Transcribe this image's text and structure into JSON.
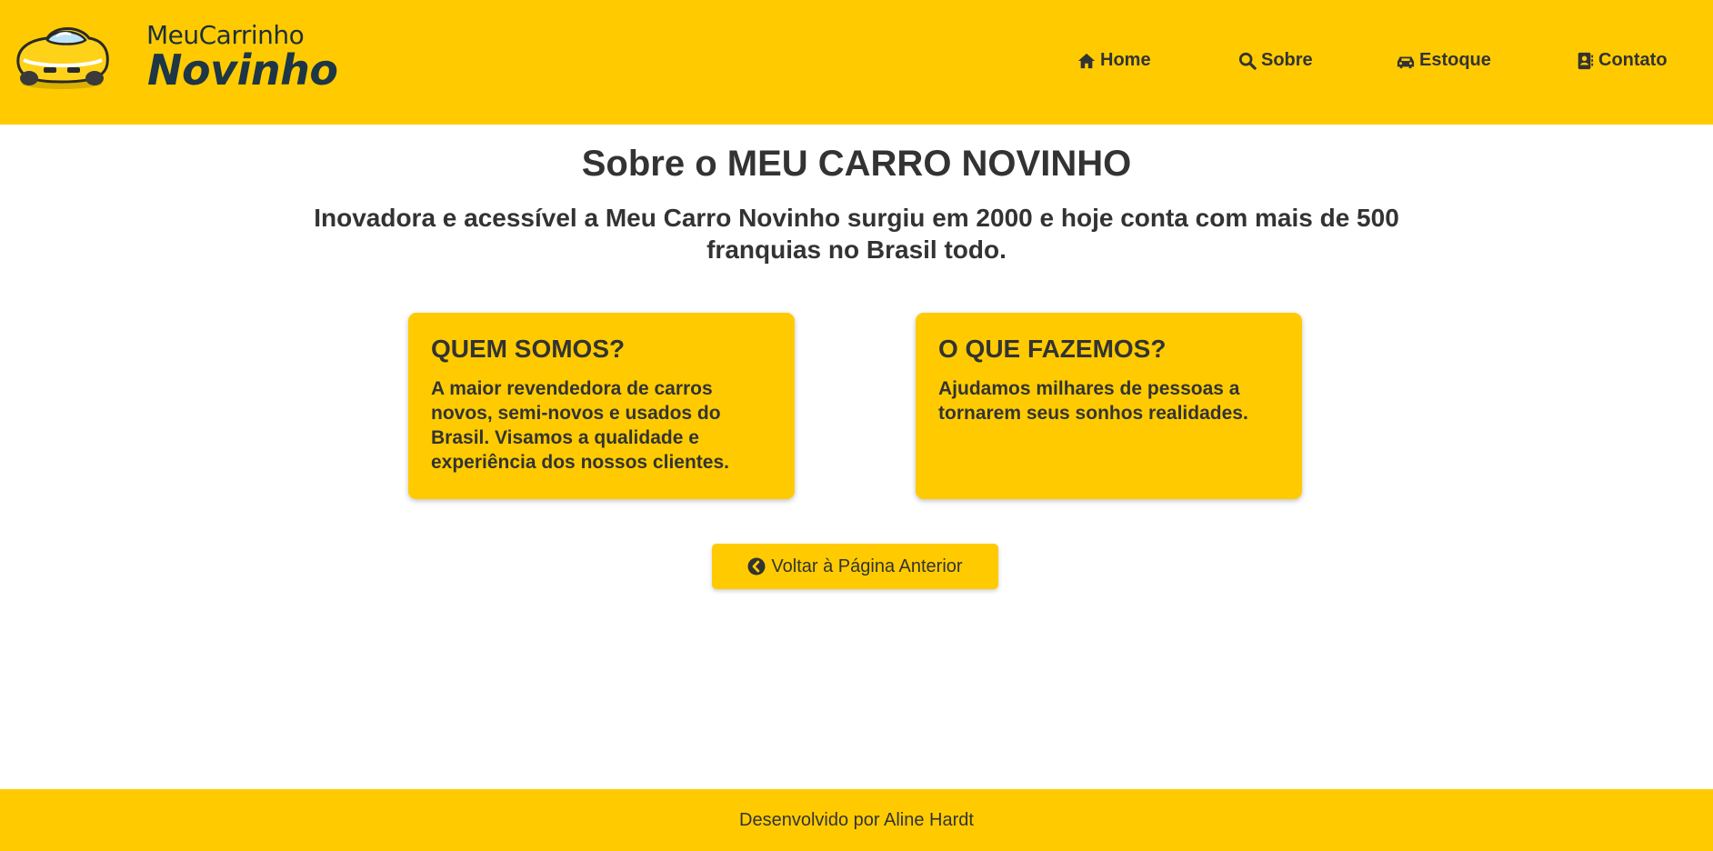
{
  "brand": {
    "line1": "MeuCarrinho",
    "line2": "Novinho"
  },
  "nav": [
    {
      "label": "Home",
      "icon": "home-icon"
    },
    {
      "label": "Sobre",
      "icon": "search-icon"
    },
    {
      "label": "Estoque",
      "icon": "car-icon"
    },
    {
      "label": "Contato",
      "icon": "contact-card-icon"
    }
  ],
  "main": {
    "title": "Sobre o MEU CARRO NOVINHO",
    "subtitle": "Inovadora e acessível a Meu Carro Novinho surgiu em 2000 e hoje conta com mais de 500 franquias no Brasil todo.",
    "cards": [
      {
        "heading": "QUEM SOMOS?",
        "text": "A maior revendedora de carros novos, semi-novos e usados do Brasil. Visamos a qualidade e experiência dos nossos clientes."
      },
      {
        "heading": "O QUE FAZEMOS?",
        "text": "Ajudamos milhares de pessoas a tornarem seus sonhos realidades."
      }
    ],
    "back_button": {
      "label": "Voltar à Página Anterior",
      "icon": "chevron-circle-left-icon"
    }
  },
  "footer": {
    "text": "Desenvolvido por Aline Hardt"
  },
  "colors": {
    "accent": "#ffcb00",
    "text": "#333333",
    "background": "#ffffff"
  }
}
